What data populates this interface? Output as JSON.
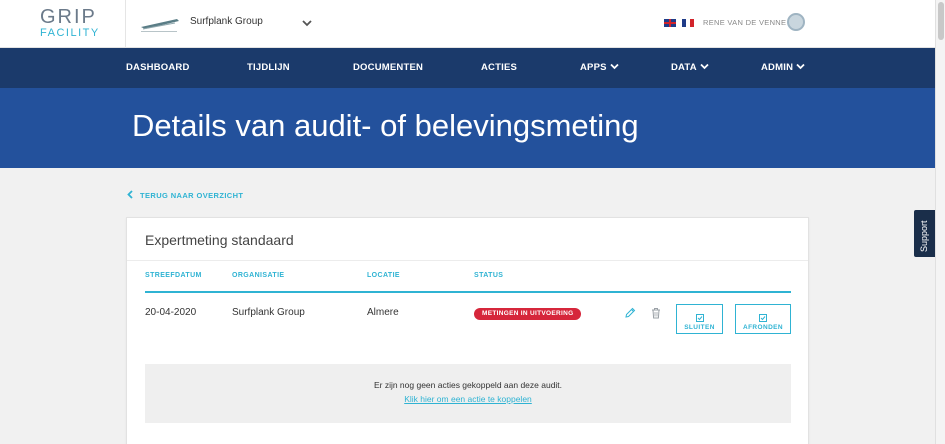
{
  "header": {
    "logo_line1": "GRIP",
    "logo_line2": "FACILITY",
    "organization": "Surfplank Group",
    "user_name": "RENE VAN DE VENNE"
  },
  "nav": {
    "items": [
      {
        "label": "DASHBOARD",
        "dropdown": false
      },
      {
        "label": "TIJDLIJN",
        "dropdown": false
      },
      {
        "label": "DOCUMENTEN",
        "dropdown": false
      },
      {
        "label": "ACTIES",
        "dropdown": false
      },
      {
        "label": "APPS",
        "dropdown": true
      },
      {
        "label": "DATA",
        "dropdown": true
      },
      {
        "label": "ADMIN",
        "dropdown": true
      }
    ]
  },
  "banner": {
    "title": "Details van audit- of belevingsmeting"
  },
  "back_link": "TERUG NAAR OVERZICHT",
  "support_label": "Support",
  "card": {
    "title": "Expertmeting standaard",
    "columns": [
      "STREEFDATUM",
      "ORGANISATIE",
      "LOCATIE",
      "STATUS"
    ],
    "row": {
      "streefdatum": "20-04-2020",
      "organisatie": "Surfplank Group",
      "locatie": "Almere",
      "status": "METINGEN IN UITVOERING"
    },
    "buttons": {
      "sluiten": "SLUITEN",
      "afronden": "AFRONDEN"
    },
    "empty_message": "Er zijn nog geen acties gekoppeld aan deze audit.",
    "empty_link": "Klik hier om een actie te koppelen"
  },
  "colors": {
    "nav_bg": "#1b3a6b",
    "banner_bg": "#23519c",
    "accent": "#2fb3d3",
    "status_red": "#d6263b"
  },
  "icons": {
    "edit": "pencil-icon",
    "delete": "trash-icon",
    "check": "checkbox-icon"
  }
}
